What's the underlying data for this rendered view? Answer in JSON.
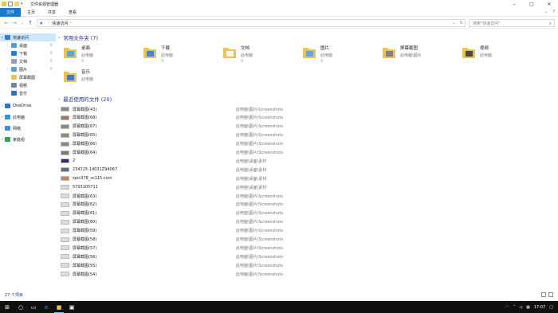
{
  "window": {
    "title": "文件资源管理器"
  },
  "ribbon": {
    "tabs": [
      "文件",
      "主页",
      "共享",
      "查看"
    ]
  },
  "address": {
    "root": "快速访问"
  },
  "search": {
    "placeholder": "搜索\"快速访问\""
  },
  "sidebar": {
    "items": [
      {
        "label": "快速访问",
        "icon": "star-icon",
        "level": 0,
        "expanded": true,
        "selected": true,
        "color": "#3a7bd5"
      },
      {
        "label": "桌面",
        "icon": "desktop-icon",
        "level": 1,
        "pinned": true,
        "color": "#4a9fe0"
      },
      {
        "label": "下载",
        "icon": "download-icon",
        "level": 1,
        "pinned": true,
        "color": "#2e7bd6"
      },
      {
        "label": "文档",
        "icon": "document-icon",
        "level": 1,
        "pinned": true,
        "color": "#8fa2b8"
      },
      {
        "label": "图片",
        "icon": "picture-icon",
        "level": 1,
        "pinned": true,
        "color": "#57a0d8"
      },
      {
        "label": "屏幕截图",
        "icon": "folder-icon",
        "level": 1,
        "color": "#e8c25a"
      },
      {
        "label": "视频",
        "icon": "video-icon",
        "level": 1,
        "color": "#6f84a3"
      },
      {
        "label": "音乐",
        "icon": "music-icon",
        "level": 1,
        "color": "#2d6fc4"
      },
      {
        "label": "OneDrive",
        "icon": "cloud-icon",
        "level": 0,
        "color": "#2b77d0"
      },
      {
        "label": "此电脑",
        "icon": "computer-icon",
        "level": 0,
        "color": "#3a8fd9"
      },
      {
        "label": "网络",
        "icon": "network-icon",
        "level": 0,
        "color": "#3a8fd9"
      },
      {
        "label": "家庭组",
        "icon": "homegroup-icon",
        "level": 0,
        "color": "#2f9e5a"
      }
    ]
  },
  "frequent": {
    "title": "常用文件夹 (7)",
    "folders": [
      {
        "name": "桌面",
        "location": "此电脑",
        "pinned": true,
        "icon": "desktop-folder-icon"
      },
      {
        "name": "下载",
        "location": "此电脑",
        "pinned": true,
        "icon": "download-folder-icon"
      },
      {
        "name": "文档",
        "location": "此电脑",
        "pinned": true,
        "icon": "document-folder-icon"
      },
      {
        "name": "图片",
        "location": "此电脑",
        "pinned": true,
        "icon": "picture-folder-icon"
      },
      {
        "name": "屏幕截图",
        "location": "此电脑\\图片",
        "pinned": false,
        "icon": "screenshot-folder-icon"
      },
      {
        "name": "视频",
        "location": "此电脑",
        "pinned": false,
        "icon": "video-folder-icon"
      },
      {
        "name": "音乐",
        "location": "此电脑",
        "pinned": false,
        "icon": "music-folder-icon"
      }
    ]
  },
  "recent": {
    "title": "最近使用的文件 (20)",
    "files": [
      {
        "name": "屏幕截图(43)",
        "path": "此电脑\\图片\\Screenshots"
      },
      {
        "name": "屏幕截图(68)",
        "path": "此电脑\\图片\\Screenshots"
      },
      {
        "name": "屏幕截图(67)",
        "path": "此电脑\\图片\\Screenshots"
      },
      {
        "name": "屏幕截图(65)",
        "path": "此电脑\\图片\\Screenshots"
      },
      {
        "name": "屏幕截图(66)",
        "path": "此电脑\\图片\\Screenshots"
      },
      {
        "name": "屏幕截图(64)",
        "path": "此电脑\\图片\\Screenshots"
      },
      {
        "name": "2",
        "path": "此电脑\\桌面\\素材"
      },
      {
        "name": "234725-14031Z94067",
        "path": "此电脑\\桌面\\素材"
      },
      {
        "name": "xpic378_sc115.com",
        "path": "此电脑\\桌面\\素材"
      },
      {
        "name": "5703105711",
        "path": "此电脑\\桌面\\素材"
      },
      {
        "name": "屏幕截图(63)",
        "path": "此电脑\\图片\\Screenshots"
      },
      {
        "name": "屏幕截图(62)",
        "path": "此电脑\\图片\\Screenshots"
      },
      {
        "name": "屏幕截图(61)",
        "path": "此电脑\\图片\\Screenshots"
      },
      {
        "name": "屏幕截图(60)",
        "path": "此电脑\\图片\\Screenshots"
      },
      {
        "name": "屏幕截图(59)",
        "path": "此电脑\\图片\\Screenshots"
      },
      {
        "name": "屏幕截图(58)",
        "path": "此电脑\\图片\\Screenshots"
      },
      {
        "name": "屏幕截图(57)",
        "path": "此电脑\\图片\\Screenshots"
      },
      {
        "name": "屏幕截图(56)",
        "path": "此电脑\\图片\\Screenshots"
      },
      {
        "name": "屏幕截图(55)",
        "path": "此电脑\\图片\\Screenshots"
      },
      {
        "name": "屏幕截图(54)",
        "path": "此电脑\\图片\\Screenshots"
      }
    ]
  },
  "status": {
    "count": "27 个项目"
  },
  "taskbar": {
    "time": "17:07",
    "accent": "#76b9ed"
  }
}
